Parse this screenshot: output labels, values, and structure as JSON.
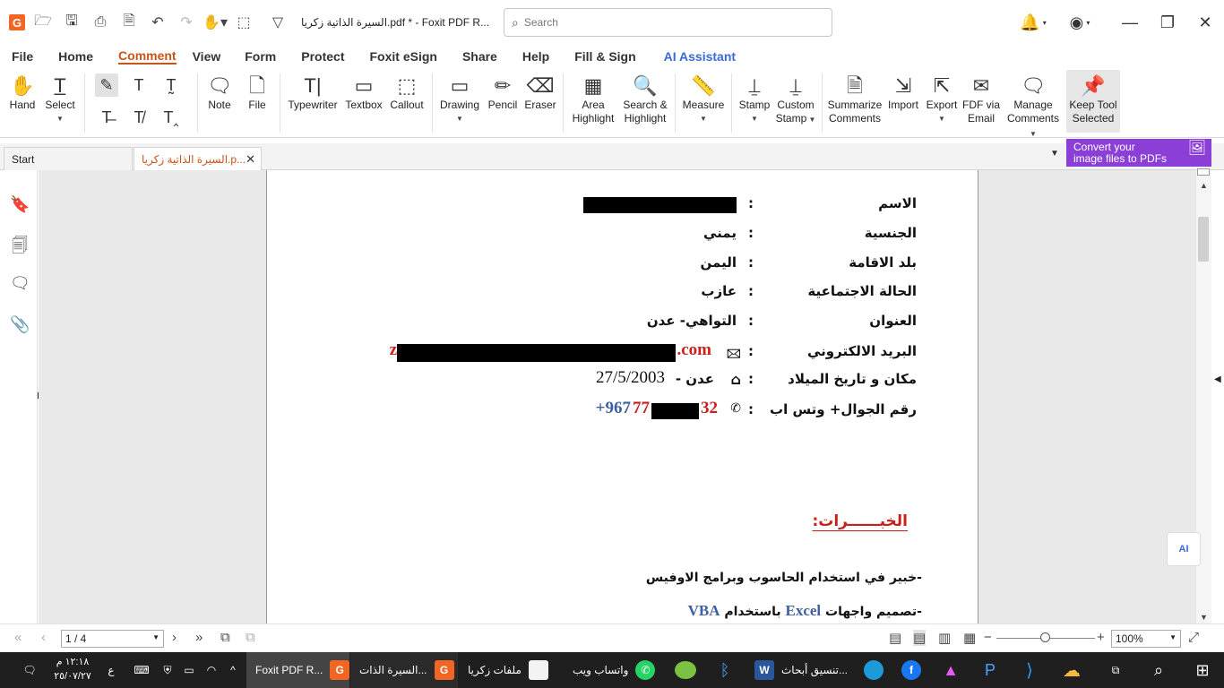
{
  "titlebar": {
    "doc_title": "السيرة الذاتية زكريا.pdf * - Foxit PDF R...",
    "search_placeholder": "Search",
    "app_logo": "G"
  },
  "menu": {
    "items": [
      "File",
      "Home",
      "Comment",
      "View",
      "Form",
      "Protect",
      "Foxit eSign",
      "Share",
      "Help",
      "Fill & Sign",
      "AI Assistant"
    ],
    "active": "Comment"
  },
  "ribbon": {
    "hand": "Hand",
    "select": "Select",
    "note": "Note",
    "file": "File",
    "typewriter": "Typewriter",
    "textbox": "Textbox",
    "callout": "Callout",
    "drawing": "Drawing",
    "pencil": "Pencil",
    "eraser": "Eraser",
    "area_highlight_1": "Area",
    "area_highlight_2": "Highlight",
    "search_highlight_1": "Search &",
    "search_highlight_2": "Highlight",
    "measure": "Measure",
    "stamp": "Stamp",
    "custom_stamp_1": "Custom",
    "custom_stamp_2": "Stamp",
    "summarize_1": "Summarize",
    "summarize_2": "Comments",
    "import": "Import",
    "export": "Export",
    "fdf_1": "FDF via",
    "fdf_2": "Email",
    "manage_1": "Manage",
    "manage_2": "Comments",
    "keep_1": "Keep Tool",
    "keep_2": "Selected"
  },
  "tabs": {
    "start": "Start",
    "doc": "السيرة الذاتية زكريا.p..."
  },
  "promo": {
    "line1": "Convert your",
    "line2": "image files to PDFs"
  },
  "document": {
    "rows": [
      {
        "label": "الاسم",
        "value": ""
      },
      {
        "label": "الجنسية",
        "value": "يمني"
      },
      {
        "label": "بلد الاقامة",
        "value": "اليمن"
      },
      {
        "label": "الحالة الاجتماعية",
        "value": "عازب"
      },
      {
        "label": "العنوان",
        "value": "التواهي- عدن"
      },
      {
        "label": "البريد الالكتروني",
        "value_start": "z",
        "value_end": ".com"
      },
      {
        "label": "مكان و تاريخ الميلاد",
        "value_city": "عدن -",
        "value_date": "27/5/2003"
      },
      {
        "label": "رقم الجوال+ وتس اب",
        "value_prefix_blue": "+967",
        "value_prefix_red": "77",
        "value_suffix": "32"
      }
    ],
    "colon": ":",
    "experience_title": "الخبــــــرات:",
    "bullet1": "-خبير في استخدام الحاسوب وبرامج الاوفيس",
    "bullet2_a": "-تصميم واجهات ",
    "bullet2_excel": "Excel",
    "bullet2_b": " باستخدام ",
    "bullet2_vba": "VBA"
  },
  "statusbar": {
    "page": "1 / 4",
    "zoom": "100%"
  },
  "taskbar": {
    "time": "١٢:١٨ م",
    "date": "٢٥/٠٧/٢٧",
    "lang": "ع",
    "apps": [
      {
        "label": "Foxit PDF R...",
        "color": "#f26522"
      },
      {
        "label": "السيرة الذات...",
        "color": "#f26522"
      },
      {
        "label": "ملفات زكريا",
        "color": "#f3c34a"
      },
      {
        "label": "واتساب ويب",
        "color": "#25d366"
      },
      {
        "label": "تنسيق أبحاث...",
        "color": "#2b579a"
      }
    ]
  },
  "colors": {
    "accent": "#c9531a",
    "ai_blue": "#3a6ad6",
    "promo_purple": "#8b3fd6",
    "doc_red": "#c8201c",
    "doc_blue": "#3e5fa0"
  }
}
